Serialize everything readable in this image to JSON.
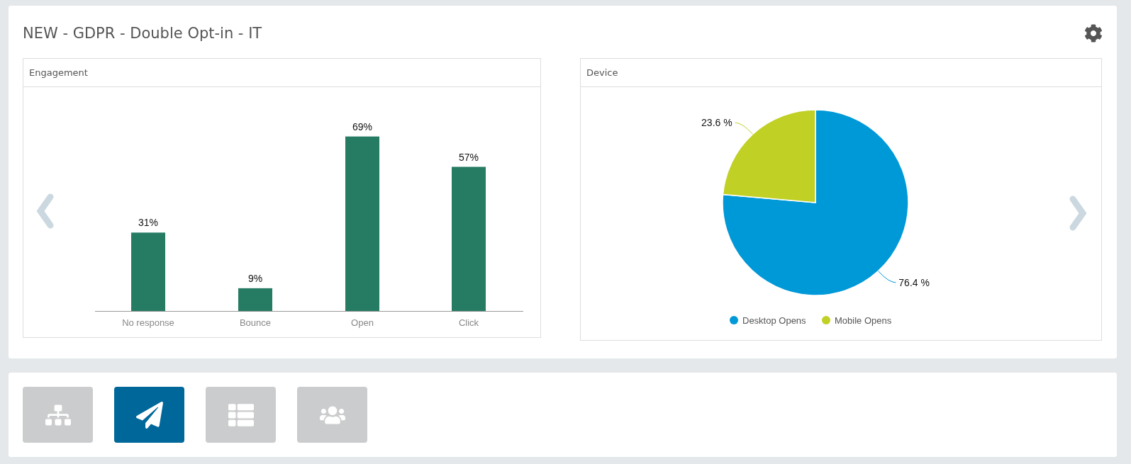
{
  "title": "NEW - GDPR - Double Opt-in - IT",
  "panels": [
    {
      "title": "Engagement",
      "chart_data": {
        "type": "bar",
        "categories": [
          "No response",
          "Bounce",
          "Open",
          "Click"
        ],
        "values": [
          31,
          9,
          69,
          57
        ],
        "data_labels": true,
        "value_labels": [
          "31%",
          "9%",
          "69%",
          "57%"
        ]
      }
    },
    {
      "title": "Device",
      "chart_data": {
        "type": "pie",
        "categories": [
          "Desktop Opens",
          "Mobile Opens"
        ],
        "values": [
          76.4,
          23.6
        ],
        "colors": [
          "#0099d8",
          "#c0d025"
        ],
        "legend": "bottom",
        "data_labels": true,
        "value_labels": [
          "76.4 %",
          "23.6 %"
        ]
      }
    }
  ],
  "toolbar": [
    {
      "kind": "hierarchy",
      "selected": false
    },
    {
      "kind": "send",
      "selected": true
    },
    {
      "kind": "list",
      "selected": false
    },
    {
      "kind": "contacts",
      "selected": false
    }
  ]
}
